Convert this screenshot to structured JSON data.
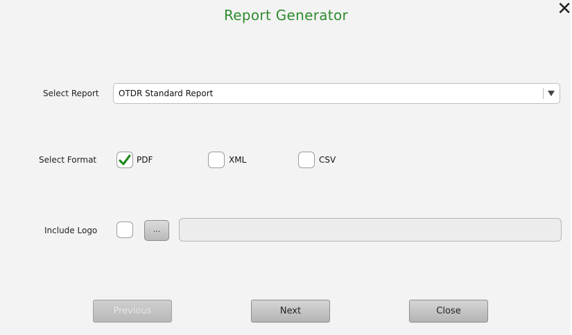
{
  "dialog": {
    "title": "Report Generator",
    "close_icon": "close-icon"
  },
  "report": {
    "label": "Select Report",
    "selected": "OTDR Standard Report"
  },
  "format": {
    "label": "Select Format",
    "options": [
      {
        "label": "PDF",
        "checked": true
      },
      {
        "label": "XML",
        "checked": false
      },
      {
        "label": "CSV",
        "checked": false
      }
    ]
  },
  "logo": {
    "label": "Include Logo",
    "checked": false,
    "browse_label": "...",
    "path_value": ""
  },
  "buttons": {
    "previous": "Previous",
    "next": "Next",
    "close": "Close"
  },
  "colors": {
    "title": "#2e8b2e",
    "check": "#1f8a1f"
  }
}
